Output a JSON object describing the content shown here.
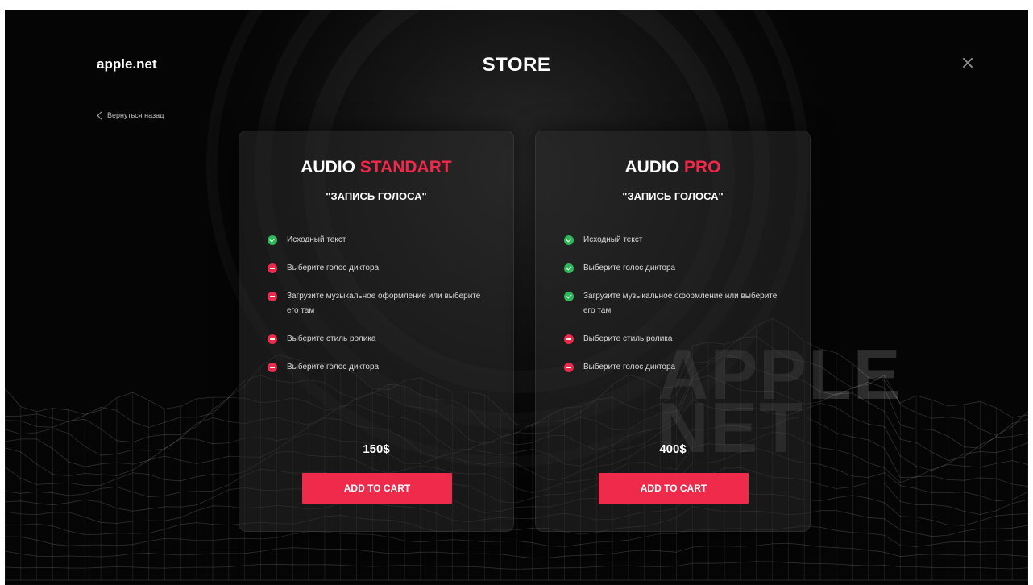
{
  "header": {
    "logo": "apple.net",
    "back_label": "Вернуться назад",
    "title": "STORE"
  },
  "watermark": {
    "line1": "APPLE",
    "line2": "NET"
  },
  "plans": [
    {
      "name_prefix": "AUDIO",
      "name_accent": "STANDART",
      "subtitle": "\"ЗАПИСЬ ГОЛОСА\"",
      "features": [
        {
          "text": "Исходный текст",
          "included": true
        },
        {
          "text": "Выберите голос диктора",
          "included": false
        },
        {
          "text": "Загрузите музыкальное оформление или выберите его там",
          "included": false
        },
        {
          "text": "Выберите стиль ролика",
          "included": false
        },
        {
          "text": "Выберите голос диктора",
          "included": false
        }
      ],
      "price": "150$",
      "button_label": "ADD TO CART"
    },
    {
      "name_prefix": "AUDIO",
      "name_accent": "PRO",
      "subtitle": "\"ЗАПИСЬ ГОЛОСА\"",
      "features": [
        {
          "text": "Исходный текст",
          "included": true
        },
        {
          "text": "Выберите голос диктора",
          "included": true
        },
        {
          "text": "Загрузите музыкальное оформление или выберите его там",
          "included": true
        },
        {
          "text": "Выберите стиль ролика",
          "included": false
        },
        {
          "text": "Выберите голос диктора",
          "included": false
        }
      ],
      "price": "400$",
      "button_label": "ADD TO CART"
    }
  ],
  "colors": {
    "accent": "#ef2a4a",
    "included": "#2fb85a",
    "excluded": "#ea2b49",
    "background": "#050505"
  },
  "icons": {
    "back": "chevron-left-icon",
    "close": "close-icon",
    "included": "check-circle-icon",
    "excluded": "cross-circle-icon"
  }
}
